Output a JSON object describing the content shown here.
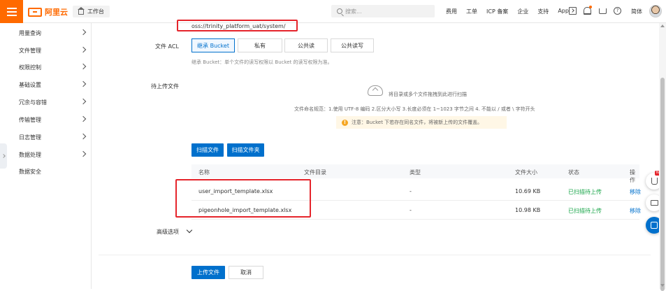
{
  "topbar": {
    "logo_text": "阿里云",
    "workbench_label": "工作台",
    "search_placeholder": "搜索...",
    "links": [
      "费用",
      "工单",
      "ICP 备案",
      "企业",
      "支持",
      "App"
    ],
    "lang": "简体",
    "accent_color": "#ff6a00"
  },
  "sidebar": {
    "items": [
      {
        "label": "用量查询",
        "has_chevron": true
      },
      {
        "label": "文件管理",
        "has_chevron": true
      },
      {
        "label": "权限控制",
        "has_chevron": true
      },
      {
        "label": "基础设置",
        "has_chevron": true
      },
      {
        "label": "冗余与容错",
        "has_chevron": true
      },
      {
        "label": "传输管理",
        "has_chevron": true
      },
      {
        "label": "日志管理",
        "has_chevron": true
      },
      {
        "label": "数据处理",
        "has_chevron": true
      },
      {
        "label": "数据安全",
        "has_chevron": false
      }
    ]
  },
  "form": {
    "path_value": "oss://trinity_platform_uat/system/",
    "acl": {
      "label": "文件 ACL",
      "options": [
        "继承 Bucket",
        "私有",
        "公共读",
        "公共读写"
      ],
      "selected": "继承 Bucket",
      "hint": "继承 Bucket：单个文件的读写权限以 Bucket 的读写权限为准。"
    },
    "upload": {
      "label": "待上传文件",
      "drop_text": "将目录或多个文件拖拽到此进行扫描",
      "naming_rule": "文件命名规范：1.使用 UTF-8 编码 2.区分大小写 3.长度必须在 1~1023 字节之间 4. 不能以 / 或者 \\ 字符开头",
      "warning": "注意：Bucket 下若存在同名文件，将被新上传的文件覆盖。",
      "scan_files_btn": "扫描文件",
      "scan_folder_btn": "扫描文件夹"
    },
    "table": {
      "columns": [
        "名称",
        "文件目录",
        "类型",
        "文件大小",
        "状态",
        "操作"
      ],
      "rows": [
        {
          "name": "user_import_template.xlsx",
          "dir": "",
          "type": "-",
          "size": "10.69 KB",
          "status": "已扫描待上传",
          "action": "移除"
        },
        {
          "name": "pigeonhole_import_template.xlsx",
          "dir": "",
          "type": "-",
          "size": "10.98 KB",
          "status": "已扫描待上传",
          "action": "移除"
        }
      ]
    },
    "advanced_label": "高级选项",
    "submit_btn": "上传文件",
    "cancel_btn": "取消"
  },
  "floating": {
    "badge": "NEW"
  },
  "colors": {
    "primary": "#0070cc",
    "success": "#1aa64a",
    "highlight": "#e5242b",
    "warning_bg": "#fff7e6"
  }
}
